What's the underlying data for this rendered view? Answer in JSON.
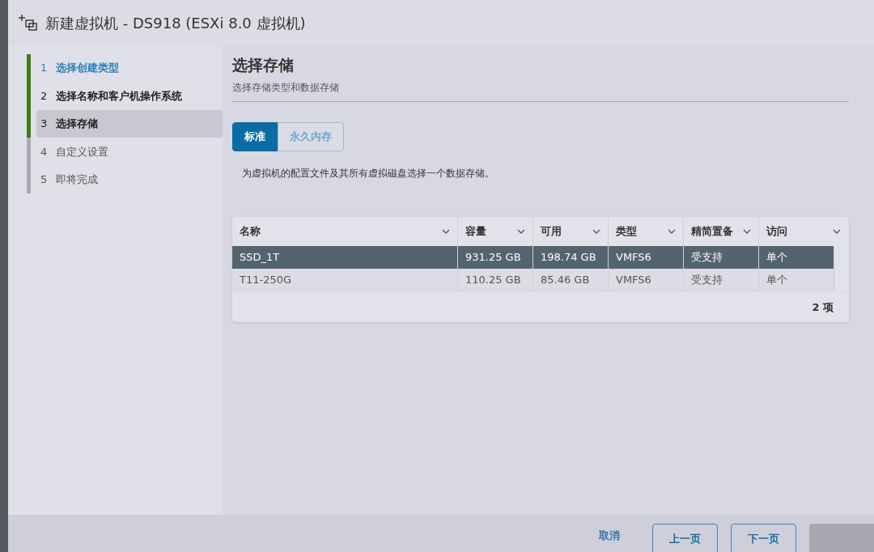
{
  "window": {
    "title": "新建虚拟机 - DS918 (ESXi 8.0 虚拟机)"
  },
  "steps": [
    {
      "number": "1",
      "label": "选择创建类型",
      "completed": true,
      "selected": false
    },
    {
      "number": "2",
      "label": "选择名称和客户机操作系统",
      "completed": true,
      "selected": false
    },
    {
      "number": "3",
      "label": "选择存储",
      "completed": true,
      "selected": true
    },
    {
      "number": "4",
      "label": "自定义设置",
      "completed": false,
      "selected": false
    },
    {
      "number": "5",
      "label": "即将完成",
      "completed": false,
      "selected": false
    }
  ],
  "page": {
    "title": "选择存储",
    "subtitle": "选择存储类型和数据存储"
  },
  "tabs": [
    {
      "label": "标准",
      "selected": true
    },
    {
      "label": "永久内存",
      "selected": false
    }
  ],
  "instruction": "为虚拟机的配置文件及其所有虚拟磁盘选择一个数据存储。",
  "table": {
    "columns": [
      "名称",
      "容量",
      "可用",
      "类型",
      "精简置备",
      "访问"
    ],
    "rows": [
      {
        "cells": [
          "SSD_1T",
          "931.25 GB",
          "198.74 GB",
          "VMFS6",
          "受支持",
          "单个"
        ],
        "selected": true
      },
      {
        "cells": [
          "T11-250G",
          "110.25 GB",
          "85.46 GB",
          "VMFS6",
          "受支持",
          "单个"
        ],
        "selected": false
      }
    ],
    "footer": "2 项"
  },
  "buttons": [
    {
      "label": "取消",
      "kind": "link"
    },
    {
      "label": "上一页",
      "kind": "outline"
    },
    {
      "label": "下一页",
      "kind": "outline"
    },
    {
      "kind": "disabled"
    }
  ]
}
